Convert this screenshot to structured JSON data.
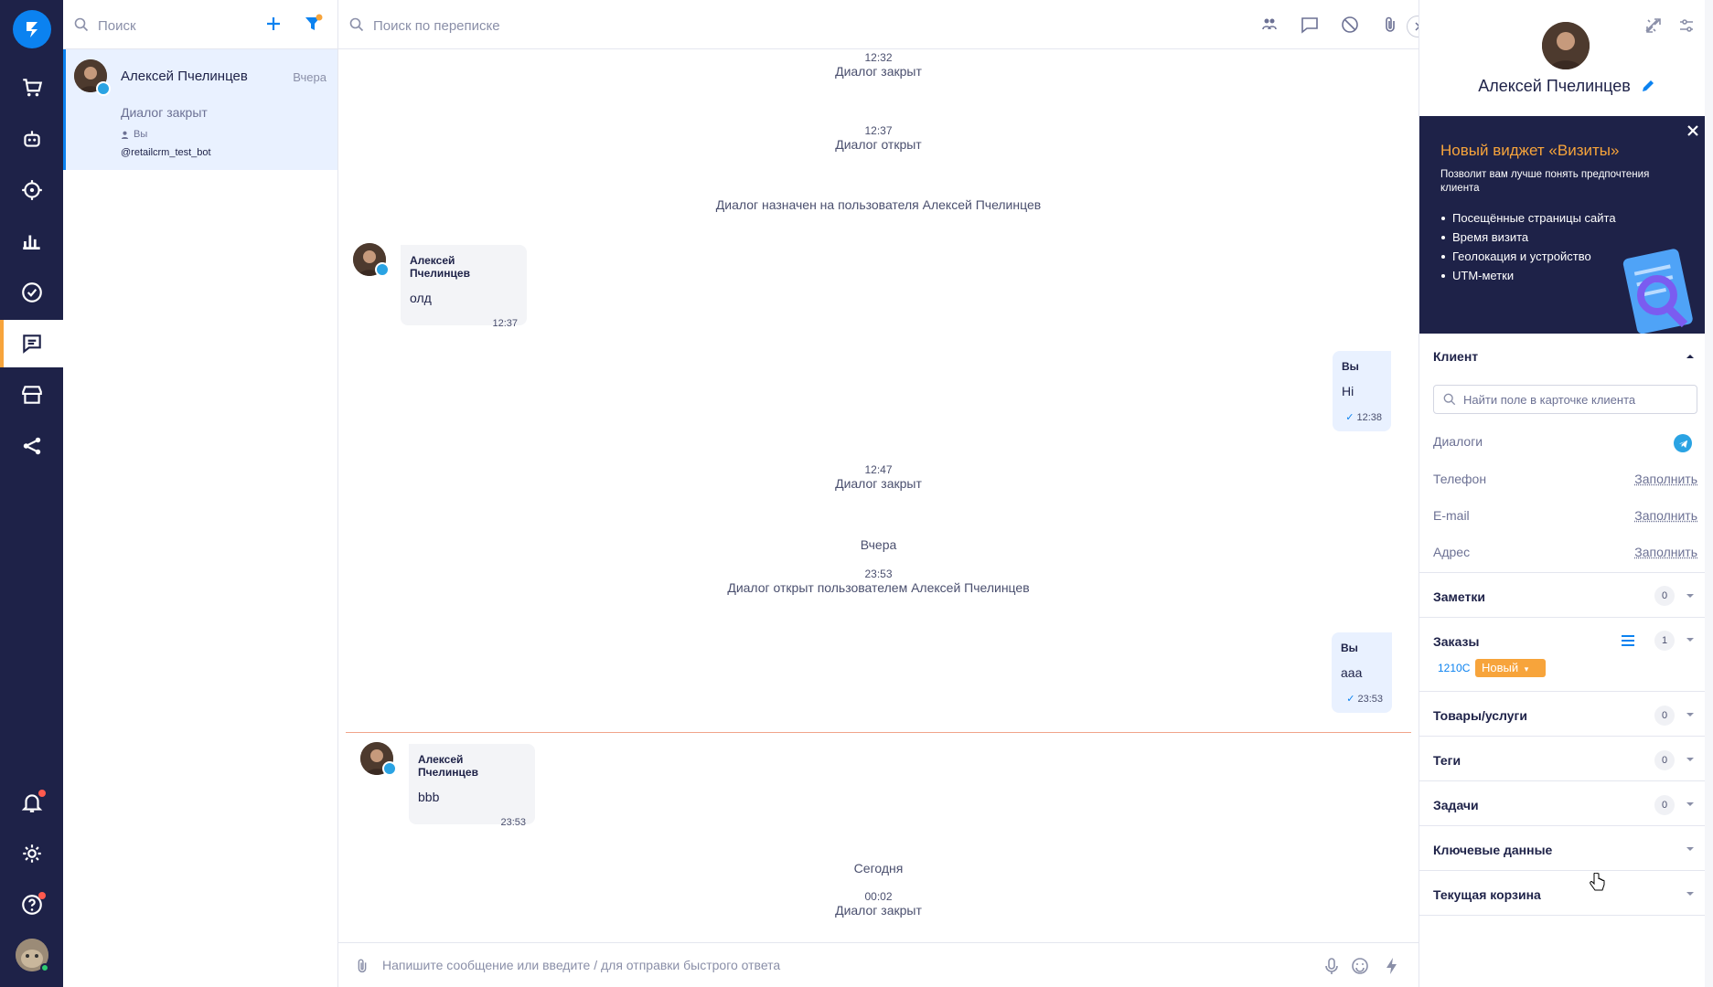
{
  "rail": {
    "items": [
      "logo-icon",
      "cart-icon",
      "bot-icon",
      "target-icon",
      "chart-icon",
      "check-circle-icon",
      "chat-icon",
      "store-icon",
      "share-icon",
      "bell-icon",
      "gear-icon",
      "help-icon"
    ]
  },
  "dialog_list": {
    "search_placeholder": "Поиск",
    "items": [
      {
        "name": "Алексей Пчелинцев",
        "time": "Вчера",
        "status": "Диалог закрыт",
        "assignee": "Вы",
        "bot": "@retailcrm_test_bot"
      }
    ]
  },
  "chat": {
    "search_placeholder": "Поиск по переписке",
    "events": [
      {
        "time": "12:32",
        "text": "Диалог закрыт"
      },
      {
        "time": "12:37",
        "text": "Диалог открыт"
      },
      {
        "text": "Диалог назначен на пользователя Алексей Пчелинцев"
      },
      {
        "time": "12:47",
        "text": "Диалог закрыт"
      },
      {
        "date": "Вчера"
      },
      {
        "time": "23:53",
        "text": "Диалог открыт пользователем Алексей Пчелинцев"
      },
      {
        "date": "Сегодня"
      },
      {
        "time": "00:02",
        "text": "Диалог закрыт"
      }
    ],
    "messages": [
      {
        "author": "Алексей Пчелинцев",
        "text": "олд",
        "time": "12:37"
      },
      {
        "author": "Вы",
        "text": "Hi",
        "time": "12:38"
      },
      {
        "author": "Вы",
        "text": "aaa",
        "time": "23:53"
      },
      {
        "author": "Алексей Пчелинцев",
        "text": "bbb",
        "time": "23:53"
      }
    ],
    "composer_placeholder": "Напишите сообщение или введите / для отправки быстрого ответа"
  },
  "panel": {
    "client_name": "Алексей Пчелинцев",
    "promo": {
      "title": "Новый виджет «Визиты»",
      "subtitle": "Позволит вам лучше понять предпочтения клиента",
      "bullets": [
        "Посещённые страницы сайта",
        "Время визита",
        "Геолокация и устройство",
        "UTM-метки"
      ]
    },
    "client_section": {
      "title": "Клиент",
      "search_placeholder": "Найти поле в карточке клиента",
      "fields": [
        {
          "label": "Диалоги",
          "value": ""
        },
        {
          "label": "Телефон",
          "value": "Заполнить"
        },
        {
          "label": "E-mail",
          "value": "Заполнить"
        },
        {
          "label": "Адрес",
          "value": "Заполнить"
        }
      ]
    },
    "sections": [
      {
        "title": "Заметки",
        "count": "0"
      },
      {
        "title": "Заказы",
        "count": "1"
      },
      {
        "title": "Товары/услуги",
        "count": "0"
      },
      {
        "title": "Теги",
        "count": "0"
      },
      {
        "title": "Задачи",
        "count": "0"
      },
      {
        "title": "Ключевые данные",
        "count": ""
      },
      {
        "title": "Текущая корзина",
        "count": ""
      }
    ],
    "order": {
      "id": "1210C",
      "status": "Новый"
    }
  },
  "colors": {
    "accent": "#0b82f0",
    "rail": "#1e2248",
    "warning": "#f7a43b"
  }
}
